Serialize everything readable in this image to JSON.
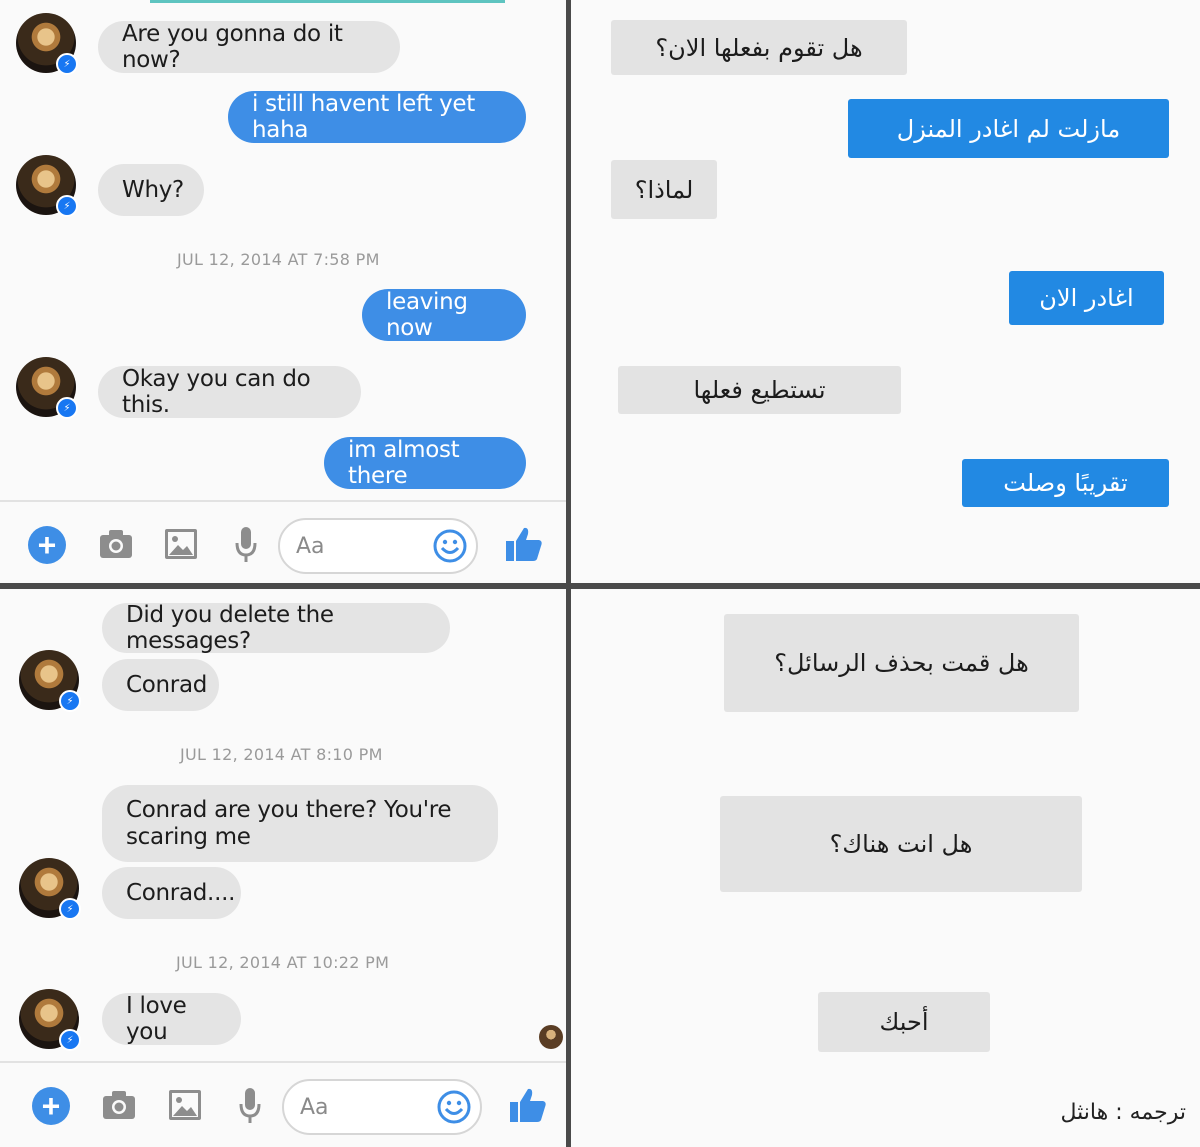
{
  "colors": {
    "outgoing": "#3e8ee6",
    "incoming": "#e4e4e4",
    "translation_out": "#2289e3",
    "divider": "#4a4a4a"
  },
  "top_chat": {
    "messages": [
      {
        "text": "Are you gonna do it now?",
        "dir": "in"
      },
      {
        "text": "i still havent left yet haha",
        "dir": "out"
      },
      {
        "text": "Why?",
        "dir": "in"
      },
      {
        "text": "leaving now",
        "dir": "out"
      },
      {
        "text": "Okay you can do this.",
        "dir": "in"
      },
      {
        "text": "im almost there",
        "dir": "out"
      }
    ],
    "timestamp": "JUL 12, 2014 AT 7:58 PM",
    "placeholder": "Aa"
  },
  "bottom_chat": {
    "messages": [
      {
        "text": "Did you delete the messages?",
        "dir": "in"
      },
      {
        "text": "Conrad",
        "dir": "in"
      },
      {
        "text": "Conrad are you there? You're scaring me",
        "dir": "in"
      },
      {
        "text": "Conrad....",
        "dir": "in"
      },
      {
        "text": "I love you",
        "dir": "in"
      }
    ],
    "timestamps": [
      "JUL 12, 2014 AT 8:10 PM",
      "JUL 12, 2014 AT 10:22 PM"
    ],
    "placeholder": "Aa"
  },
  "top_translation": [
    "هل تقوم بفعلها الان؟",
    "مازلت لم اغادر المنزل",
    "لماذا؟",
    "اغادر الان",
    "تستطيع فعلها",
    "تقريبًا وصلت"
  ],
  "bottom_translation": [
    "هل قمت بحذف الرسائل؟",
    "هل انت هناك؟",
    "أحبك"
  ],
  "credit": "ترجمه : هانثل",
  "icons": [
    "plus-icon",
    "camera-icon",
    "image-icon",
    "microphone-icon",
    "emoji-icon",
    "thumbs-up-icon",
    "messenger-badge-icon"
  ]
}
